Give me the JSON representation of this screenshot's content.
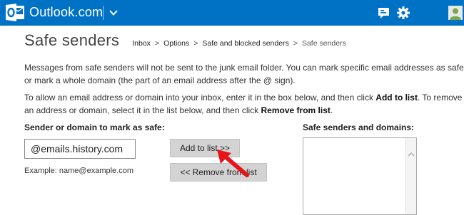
{
  "header": {
    "brand": "Outlook.com",
    "brand_color": "#0072c6",
    "icons": [
      "outlook-logo-icon",
      "chevron-down-icon",
      "messaging-icon",
      "gear-icon",
      "avatar"
    ]
  },
  "page": {
    "title": "Safe senders",
    "breadcrumb": {
      "items": [
        "Inbox",
        "Options",
        "Safe and blocked senders"
      ],
      "separator": ">",
      "current": "Safe senders"
    }
  },
  "instructions": {
    "p1_line1": "Messages from safe senders will not be sent to the junk email folder. You can mark specific email addresses as safe",
    "p1_line2": "or mark a whole domain (the part of an email address after the @ sign).",
    "p2_a": "To allow an email address or domain into your inbox, enter it in the box below, and then click ",
    "p2_add": "Add to list",
    "p2_b": ". To remove",
    "p2_c": "an address or domain, select it in the list below, and then click ",
    "p2_remove": "Remove from list",
    "p2_d": "."
  },
  "form": {
    "sender_label": "Sender or domain to mark as safe:",
    "sender_value": "@emails.history.com",
    "example": "Example: name@example.com",
    "add_button": "Add to list >>",
    "remove_button": "<< Remove from list",
    "list_label": "Safe senders and domains:"
  },
  "annotation": {
    "arrow_color": "#e8141b"
  }
}
